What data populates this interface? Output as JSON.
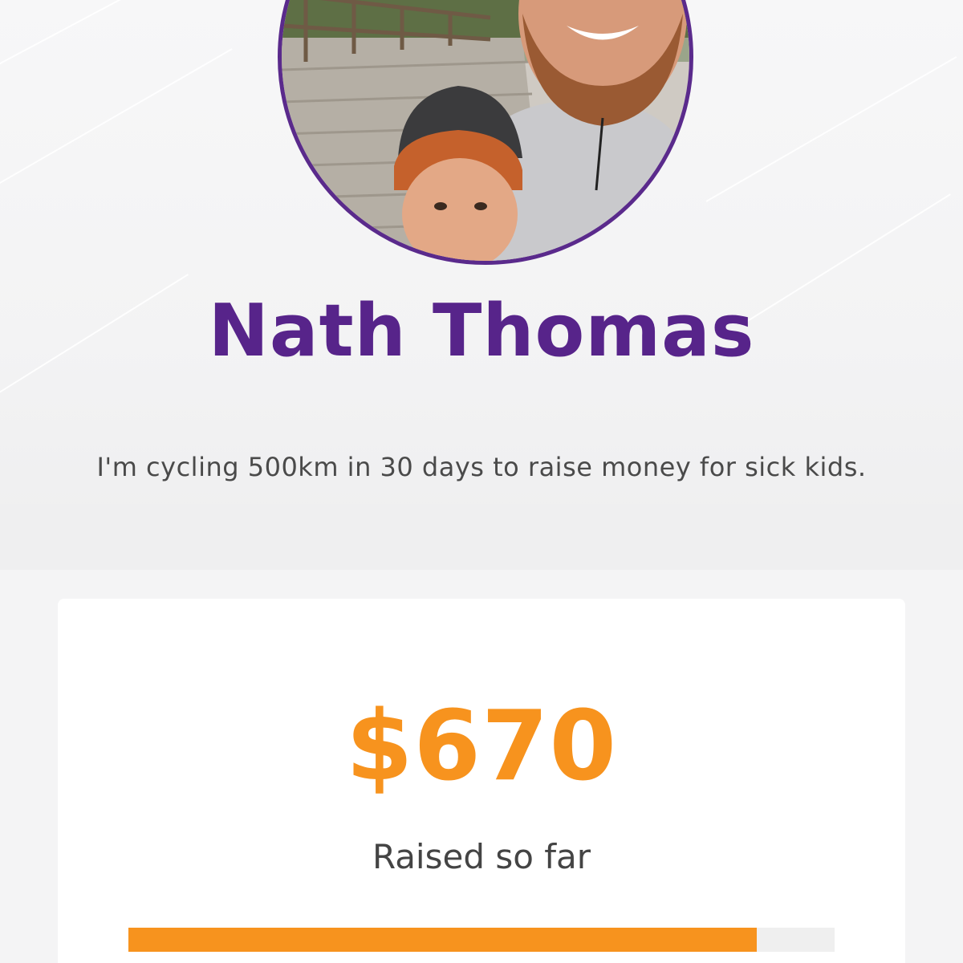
{
  "profile": {
    "name": "Nath Thomas",
    "tagline": "I'm cycling 500km in 30 days to raise money for sick kids.",
    "avatar_icon": "profile-photo"
  },
  "fundraising": {
    "amount": "$670",
    "amount_label": "Raised so far",
    "progress_fraction": 0.89
  },
  "colors": {
    "brand_purple": "#57248a",
    "accent_orange": "#f7931e",
    "background": "#f4f4f5",
    "card": "#ffffff"
  }
}
